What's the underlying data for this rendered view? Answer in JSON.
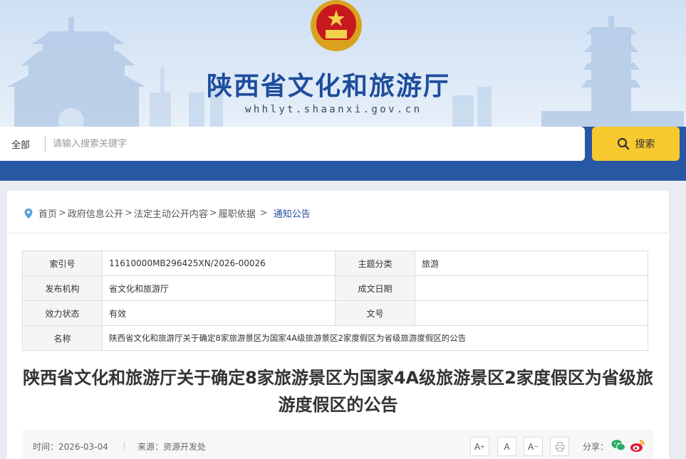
{
  "header": {
    "title": "陕西省文化和旅游厅",
    "url": "whhlyt.shaanxi.gov.cn",
    "emblem_icon": "national-emblem-icon"
  },
  "search": {
    "scope": "全部",
    "placeholder": "请输入搜索关键字",
    "button_label": "搜索"
  },
  "breadcrumb": {
    "items": [
      "首页",
      "政府信息公开",
      "法定主动公开内容",
      "履职依据"
    ],
    "current": "通知公告"
  },
  "meta": {
    "index_label": "索引号",
    "index_value": "11610000MB296425XN/2026-00026",
    "topic_label": "主题分类",
    "topic_value": "旅游",
    "publisher_label": "发布机构",
    "publisher_value": "省文化和旅游厅",
    "date_label": "成文日期",
    "date_value": "",
    "status_label": "效力状态",
    "status_value": "有效",
    "docno_label": "文号",
    "docno_value": "",
    "name_label": "名称",
    "name_value": "陕西省文化和旅游厅关于确定8家旅游景区为国家4A级旅游景区2家度假区为省级旅游度假区的公告"
  },
  "article": {
    "title": "陕西省文化和旅游厅关于确定8家旅游景区为国家4A级旅游景区2家度假区为省级旅游度假区的公告",
    "time": "时间：2026-03-04",
    "source": "来源：资源开发处",
    "font_increase": "A",
    "font_normal": "A",
    "font_decrease": "A",
    "share_label": "分享："
  },
  "colors": {
    "brand_blue": "#2857a4",
    "title_blue": "#1f4d9c",
    "search_yellow": "#f7c92f"
  }
}
